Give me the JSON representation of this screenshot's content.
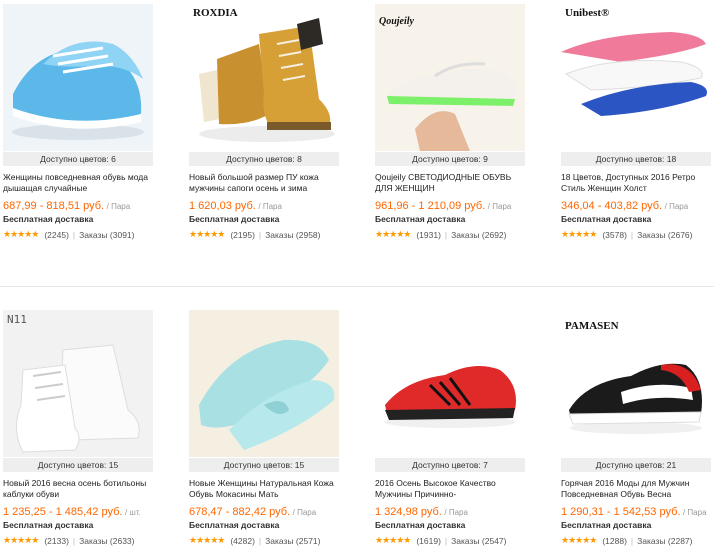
{
  "products": [
    {
      "brand": "",
      "colors": "Доступно цветов: 6",
      "title": "Женщины повседневная обувь мода дышащая случайные",
      "price": "687,99 - 818,51 руб.",
      "unit": "/ Пара",
      "shipping": "Бесплатная доставка",
      "stars": "★★★★★",
      "reviews": "(2245)",
      "orders": "Заказы (3091)"
    },
    {
      "brand": "ROXDIA",
      "colors": "Доступно цветов: 8",
      "title": "Новый большой размер ПУ кожа мужчины сапоги осень и зима",
      "price": "1 620,03 руб.",
      "unit": "/ Пара",
      "shipping": "Бесплатная доставка",
      "stars": "★★★★★",
      "reviews": "(2195)",
      "orders": "Заказы (2958)"
    },
    {
      "brand": "Qoujeily",
      "colors": "Доступно цветов: 9",
      "title": "Qoujeily СВЕТОДИОДНЫЕ ОБУВЬ ДЛЯ ЖЕНЩИН",
      "price": "961,96 - 1 210,09 руб.",
      "unit": "/ Пара",
      "shipping": "Бесплатная доставка",
      "stars": "★★★★★",
      "reviews": "(1931)",
      "orders": "Заказы (2692)"
    },
    {
      "brand": "Unibest®",
      "colors": "Доступно цветов: 18",
      "title": "18 Цветов, Доступных 2016 Ретро Стиль Женщин Холст",
      "price": "346,04 - 403,82 руб.",
      "unit": "/ Пара",
      "shipping": "Бесплатная доставка",
      "stars": "★★★★★",
      "reviews": "(3578)",
      "orders": "Заказы (2676)"
    },
    {
      "brand": "N11",
      "colors": "Доступно цветов: 15",
      "title": "Новый 2016 весна осень ботильоны каблуки обуви",
      "price": "1 235,25 - 1 485,42 руб.",
      "unit": "/ шт.",
      "shipping": "Бесплатная доставка",
      "stars": "★★★★★",
      "reviews": "(2133)",
      "orders": "Заказы (2633)"
    },
    {
      "brand": "",
      "colors": "Доступно цветов: 15",
      "title": "Новые Женщины Натуральная Кожа Обувь Мокасины Мать",
      "price": "678,47 - 882,42 руб.",
      "unit": "/ Пара",
      "shipping": "Бесплатная доставка",
      "stars": "★★★★★",
      "reviews": "(4282)",
      "orders": "Заказы (2571)"
    },
    {
      "brand": "",
      "colors": "Доступно цветов: 7",
      "title": "2016 Осень Высокое Качество Мужчины Причинно-",
      "price": "1 324,98 руб.",
      "unit": "/ Пара",
      "shipping": "Бесплатная доставка",
      "stars": "★★★★★",
      "reviews": "(1619)",
      "orders": "Заказы (2547)"
    },
    {
      "brand": "PAMASEN",
      "colors": "Доступно цветов: 21",
      "title": "Горячая 2016 Моды для Мужчин Повседневная Обувь Весна",
      "price": "1 290,31 - 1 542,53 руб.",
      "unit": "/ Пара",
      "shipping": "Бесплатная доставка",
      "stars": "★★★★★",
      "reviews": "(1288)",
      "orders": "Заказы (2287)"
    }
  ]
}
